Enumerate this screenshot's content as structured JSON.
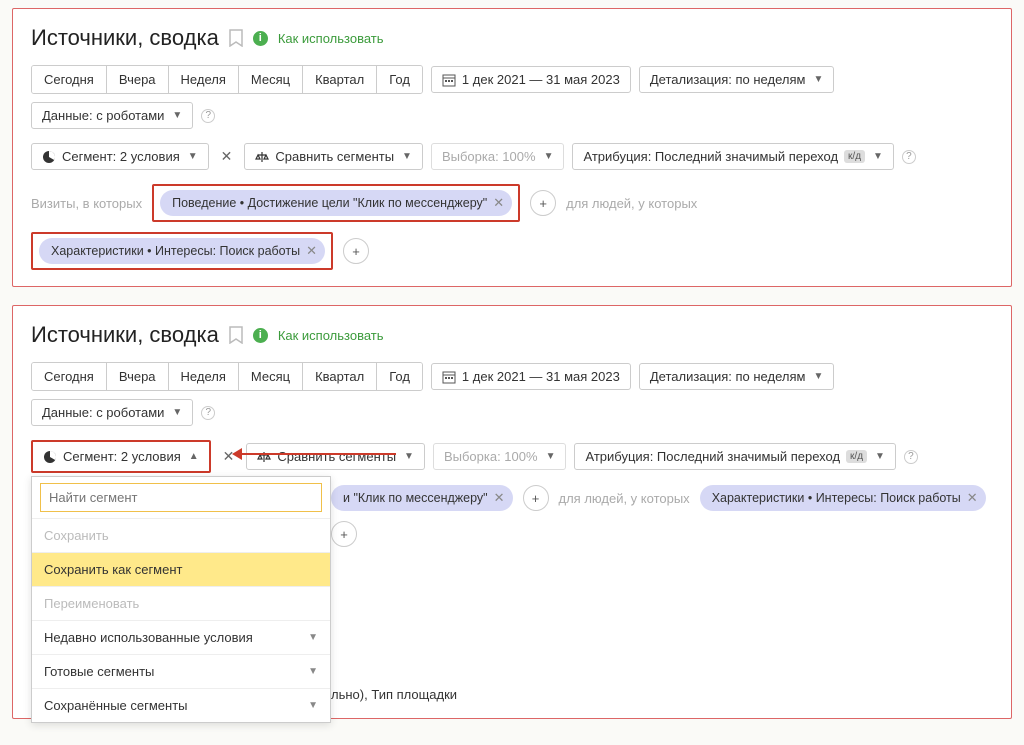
{
  "panel1": {
    "title": "Источники, сводка",
    "help": "Как использовать",
    "periods": [
      "Сегодня",
      "Вчера",
      "Неделя",
      "Месяц",
      "Квартал",
      "Год"
    ],
    "dateRange": "1 дек 2021 — 31 мая 2023",
    "detail": "Детализация: по неделям",
    "dataMode": "Данные: с роботами",
    "segment": "Сегмент: 2 условия",
    "compare": "Сравнить сегменты",
    "sample": "Выборка: 100%",
    "attribution": "Атрибуция: Последний значимый переход",
    "attrBadge": "к/д",
    "visitsLabel": "Визиты, в которых",
    "chip1": "Поведение • Достижение цели \"Клик по мессенджеру\"",
    "peopleLabel": "для людей, у которых",
    "chip2": "Характеристики • Интересы: Поиск работы"
  },
  "panel2": {
    "title": "Источники, сводка",
    "help": "Как использовать",
    "periods": [
      "Сегодня",
      "Вчера",
      "Неделя",
      "Месяц",
      "Квартал",
      "Год"
    ],
    "dateRange": "1 дек 2021 — 31 мая 2023",
    "detail": "Детализация: по неделям",
    "dataMode": "Данные: с роботами",
    "segment": "Сегмент: 2 условия",
    "compare": "Сравнить сегменты",
    "sample": "Выборка: 100%",
    "attribution": "Атрибуция: Последний значимый переход",
    "attrBadge": "к/д",
    "chipFragment": "и \"Клик по мессенджеру\"",
    "peopleLabel": "для людей, у которых",
    "chip2": "Характеристики • Интересы: Поиск работы",
    "dropdown": {
      "searchPlaceholder": "Найти сегмент",
      "save": "Сохранить",
      "saveAs": "Сохранить как сегмент",
      "rename": "Переименовать",
      "recent": "Недавно использованные условия",
      "ready": "Готовые сегменты",
      "saved": "Сохранённые сегменты"
    },
    "trailing": "льно), Тип площадки"
  }
}
